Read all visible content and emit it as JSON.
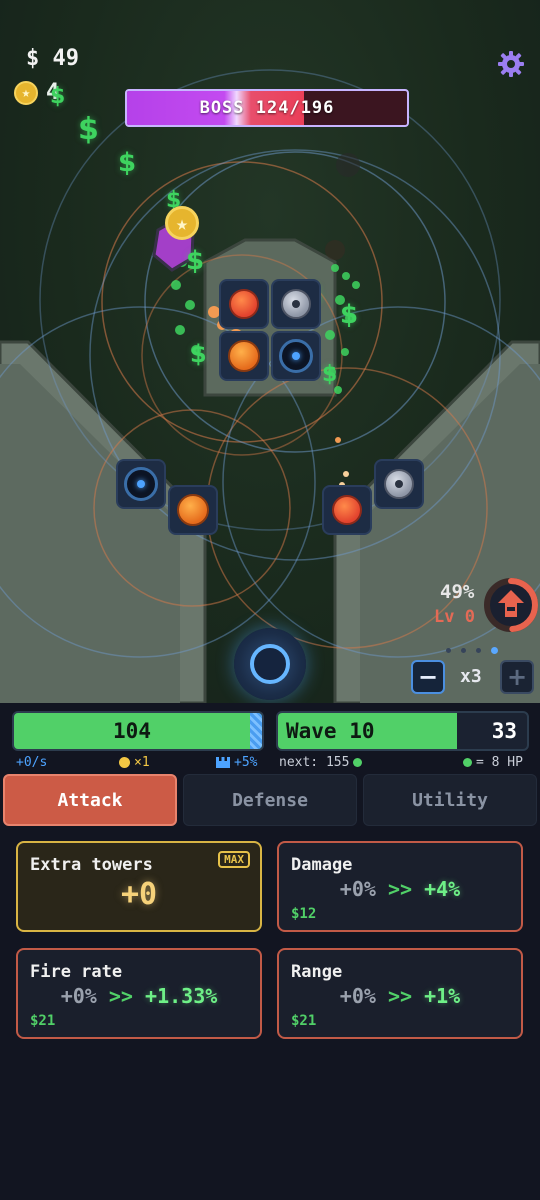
{
  "hud": {
    "money": "$ 49",
    "stars": "4"
  },
  "boss": {
    "label": "BOSS 124/196",
    "hp": 124,
    "hp_max": 196
  },
  "boost": {
    "percent": "49%",
    "level": "Lv 0",
    "progress": 0.49
  },
  "speed": {
    "minus_label": "−",
    "plus_label": "+",
    "value": "x3",
    "page_dots": 4,
    "active_dot": 4
  },
  "status": {
    "hp_value": "104",
    "wave_label": "Wave 10",
    "wave_count": "33",
    "wave_progress": 0.72
  },
  "stats": {
    "income": "+0/s",
    "coin_mult": "×1",
    "wall_bonus": "+5%",
    "next_label": "next: 155",
    "hp_rate": "= 8 HP"
  },
  "tabs": [
    {
      "label": "Attack",
      "active": true
    },
    {
      "label": "Defense",
      "active": false
    },
    {
      "label": "Utility",
      "active": false
    }
  ],
  "upgrades": {
    "extra_towers": {
      "title": "Extra towers",
      "badge": "MAX",
      "value": "+0"
    },
    "damage": {
      "title": "Damage",
      "from": "+0%",
      "arrow": ">>",
      "to": "+4%",
      "cost": "$12"
    },
    "fire_rate": {
      "title": "Fire rate",
      "from": "+0%",
      "arrow": ">>",
      "to": "+1.33%",
      "cost": "$21"
    },
    "range": {
      "title": "Range",
      "from": "+0%",
      "arrow": ">>",
      "to": "+1%",
      "cost": "$21"
    }
  },
  "floating_text": {
    "dollar": "$"
  },
  "colors": {
    "accent_attack": "#cc5b46",
    "hp_green": "#51d068",
    "boss_purple": "#c34af0",
    "boss_red": "#ea3f58",
    "max_gold": "#d8b444",
    "info_blue": "#4da3ff"
  },
  "icons": {
    "settings": "gear-icon",
    "star": "star-icon",
    "boost": "up-arrow-icon",
    "wall": "wall-icon"
  }
}
